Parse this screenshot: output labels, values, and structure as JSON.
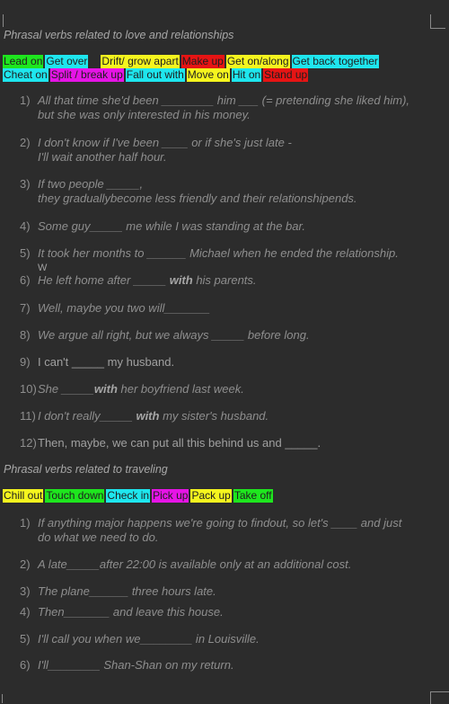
{
  "section1": {
    "title": "Phrasal verbs related to love and relationships",
    "tags_row1": [
      {
        "label": "Lead on",
        "color": "#1ee61e"
      },
      {
        "label": "Get over",
        "color": "#1ee6ee"
      },
      {
        "label": "Drift/ grow apart",
        "color": "#f5f51e"
      },
      {
        "label": "Make up",
        "color": "#e61414"
      },
      {
        "label": "Get on/along",
        "color": "#f5f51e"
      },
      {
        "label": "Get back together",
        "color": "#1ee6ee"
      }
    ],
    "tags_row2": [
      {
        "label": "Cheat on",
        "color": "#1ee6ee"
      },
      {
        "label": "Split / break up",
        "color": "#e614e6"
      },
      {
        "label": "Fall out with",
        "color": "#1ee6ee"
      },
      {
        "label": "Move on",
        "color": "#f5f51e"
      },
      {
        "label": "Hit on",
        "color": "#1ee6ee"
      },
      {
        "label": "Stand up",
        "color": "#e61414"
      }
    ],
    "items": [
      {
        "num": "1)",
        "line1": "All that time she'd been ________ him ___ (= pretending she liked him),",
        "line2": "but she was only interested in his money."
      },
      {
        "num": "2)",
        "line1": "I don't know if I've been ____ or if she's just late -",
        "line2": "I'll wait another half hour."
      },
      {
        "num": "3)",
        "line1": "If two people _____,",
        "line2": "they graduallybecome less friendly and their relationshipends."
      },
      {
        "num": "4)",
        "line1": "Some guy_____ me while I was standing at the bar."
      },
      {
        "num": "5)",
        "line1": "It took her months to ______ Michael when he ended the relationship."
      },
      {
        "num": "6)",
        "pre": "He left home after _____ ",
        "bold": "with",
        "post": " his parents."
      },
      {
        "num": "7)",
        "line1": "Well, maybe you two will_______"
      },
      {
        "num": "8)",
        "line1": "We argue all right, but we always _____ before long."
      },
      {
        "num": "9)",
        "line1": "I can't _____ my husband."
      },
      {
        "num": "10)",
        "pre": "She _____",
        "bold": "with",
        "post": " her boyfriend last week."
      },
      {
        "num": "11)",
        "pre": "I don't really_____ ",
        "bold": "with",
        "post": " my sister's husband."
      },
      {
        "num": "12)",
        "line1": "Then, maybe, we can put all this behind us and _____."
      }
    ],
    "stray_mark": "W"
  },
  "section2": {
    "title": "Phrasal verbs related to traveling",
    "tags": [
      {
        "label": "Chill out",
        "color": "#f5f51e"
      },
      {
        "label": "Touch down",
        "color": "#1ee61e"
      },
      {
        "label": "Check in",
        "color": "#1ee6ee"
      },
      {
        "label": "Pick up",
        "color": "#e614e6"
      },
      {
        "label": "Pack up",
        "color": "#f5f51e"
      },
      {
        "label": "Take off",
        "color": "#1ee61e"
      }
    ],
    "items": [
      {
        "num": "1)",
        "line1": "If anything major happens we're going to findout, so let's ____ and just",
        "line2": "do what we need to do."
      },
      {
        "num": "2)",
        "line1": "A late_____after 22:00 is available only at an additional cost."
      },
      {
        "num": "3)",
        "line1": "The plane______ three hours late."
      },
      {
        "num": "4)",
        "line1": "Then_______ and leave this house."
      },
      {
        "num": "5)",
        "line1": "I'll call you when we________ in Louisville."
      },
      {
        "num": "6)",
        "line1": "I'll________ Shan-Shan on my return."
      }
    ]
  }
}
